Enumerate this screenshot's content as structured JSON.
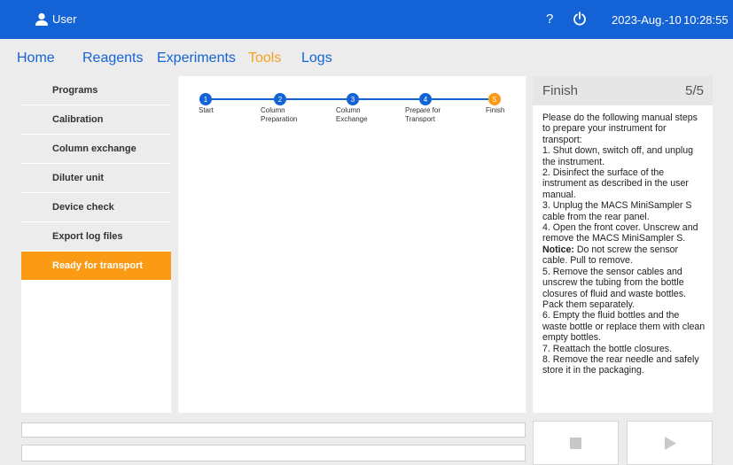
{
  "topbar": {
    "user_label": "User",
    "help_glyph": "?",
    "date": "2023-Aug.-10",
    "time": "10:28:55",
    "icons": [
      "user-icon",
      "help-icon",
      "power-icon"
    ]
  },
  "nav": {
    "items": [
      "Home",
      "Reagents",
      "Experiments",
      "Tools",
      "Logs"
    ],
    "active": "Tools"
  },
  "sidebar": {
    "items": [
      "Programs",
      "Calibration",
      "Column exchange",
      "Diluter unit",
      "Device check",
      "Export log files",
      "Ready for transport"
    ],
    "active": "Ready for transport"
  },
  "stepper": {
    "steps": [
      {
        "num": "1",
        "label_line1": "Start",
        "label_line2": ""
      },
      {
        "num": "2",
        "label_line1": "Column",
        "label_line2": "Preparation"
      },
      {
        "num": "3",
        "label_line1": "Column",
        "label_line2": "Exchange"
      },
      {
        "num": "4",
        "label_line1": "Prepare for",
        "label_line2": "Transport"
      },
      {
        "num": "5",
        "label_line1": "Finish",
        "label_line2": ""
      }
    ],
    "current": 5
  },
  "finish": {
    "title": "Finish",
    "progress": "5/5",
    "intro": "Please do the following manual steps to prepare your instrument for transport:",
    "step1": "1. Shut down, switch off, and unplug the instrument.",
    "step2": "2. Disinfect the surface of the instrument as described in the user manual.",
    "step3": "3. Unplug the MACS MiniSampler S cable from the rear panel.",
    "step4": "4. Open the front cover. Unscrew and remove the MACS MiniSampler S.",
    "notice_label": "Notice:",
    "notice_text": " Do not screw the sensor cable. Pull to remove.",
    "step5": "5. Remove the sensor cables and unscrew the tubing from the bottle closures of fluid and waste bottles. Pack them separately.",
    "step6": "6. Empty the fluid bottles and the waste bottle or replace them with clean empty bottles.",
    "step7": "7. Reattach the bottle closures.",
    "step8": "8. Remove the rear needle and safely store it in the packaging."
  },
  "controls": {
    "icons": [
      "stop-icon",
      "play-icon"
    ]
  },
  "colors": {
    "accent_blue": "#1463d6",
    "accent_orange": "#fb9a14",
    "background": "#ececec"
  }
}
